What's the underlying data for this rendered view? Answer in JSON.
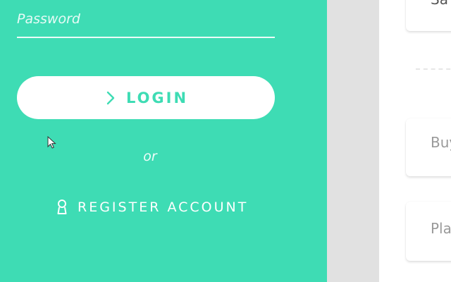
{
  "login_form": {
    "password_placeholder": "Password",
    "login_label": "LOGIN",
    "or_text": "or",
    "register_label": "REGISTER ACCOUNT",
    "icons": {
      "login": "chevron-right-icon",
      "register": "user-icon",
      "cursor": "mouse-cursor-icon"
    }
  },
  "side_cards": {
    "top_label": "Sa",
    "buy_label": "Buy",
    "plan_label": "Pla"
  },
  "colors": {
    "accent": "#3edcb4",
    "background": "#e1e1e1",
    "panel": "#ffffff",
    "muted_text": "#9a9a9a"
  }
}
